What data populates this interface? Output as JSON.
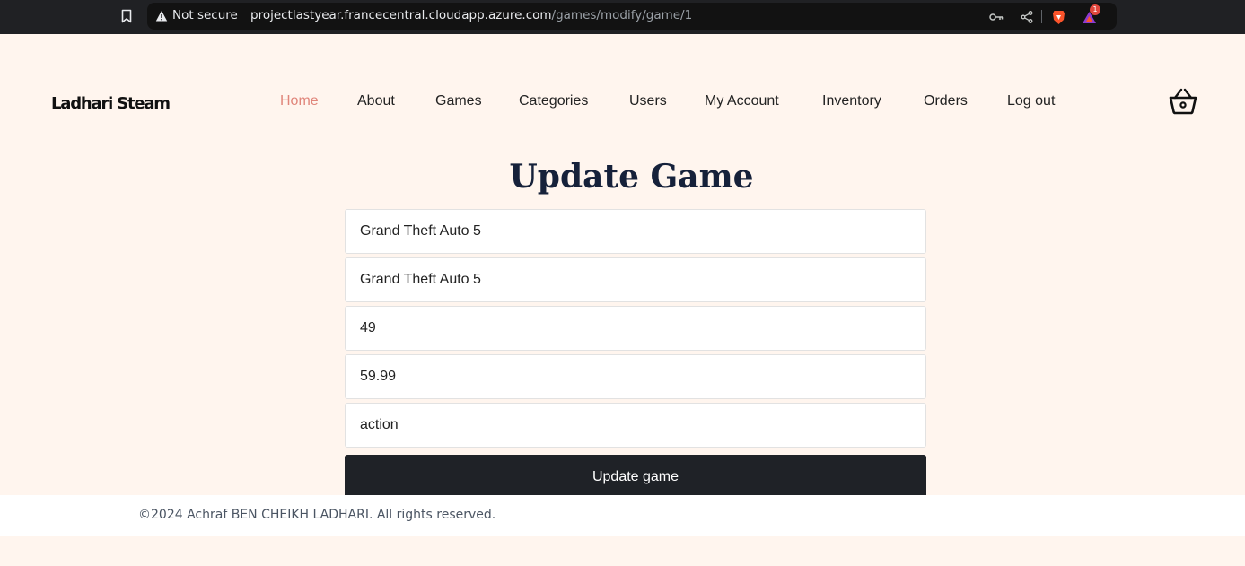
{
  "browser": {
    "security_label": "Not secure",
    "url_host": "projectlastyear.francecentral.cloudapp.azure.com",
    "url_path": "/games/modify/game/1",
    "rewards_badge": "1"
  },
  "header": {
    "logo": "Ladhari Steam",
    "nav": [
      {
        "label": "Home"
      },
      {
        "label": "About"
      },
      {
        "label": "Games"
      },
      {
        "label": "Categories"
      },
      {
        "label": "Users"
      },
      {
        "label": "My Account"
      },
      {
        "label": "Inventory"
      },
      {
        "label": "Orders"
      },
      {
        "label": "Log out"
      }
    ],
    "active_nav": "Home",
    "cart_icon": "basket-icon"
  },
  "form": {
    "title": "Update Game",
    "fields": [
      {
        "value": "Grand Theft Auto 5"
      },
      {
        "value": "Grand Theft Auto 5"
      },
      {
        "value": "49"
      },
      {
        "value": "59.99"
      },
      {
        "value": "action"
      }
    ],
    "submit_label": "Update game"
  },
  "footer": {
    "copyright": "©2024 Achraf BEN CHEIKH LADHARI. All rights reserved."
  },
  "colors": {
    "background": "#fff5ee",
    "accent": "#e0857a",
    "button": "#1f2227",
    "title": "#16213a"
  }
}
